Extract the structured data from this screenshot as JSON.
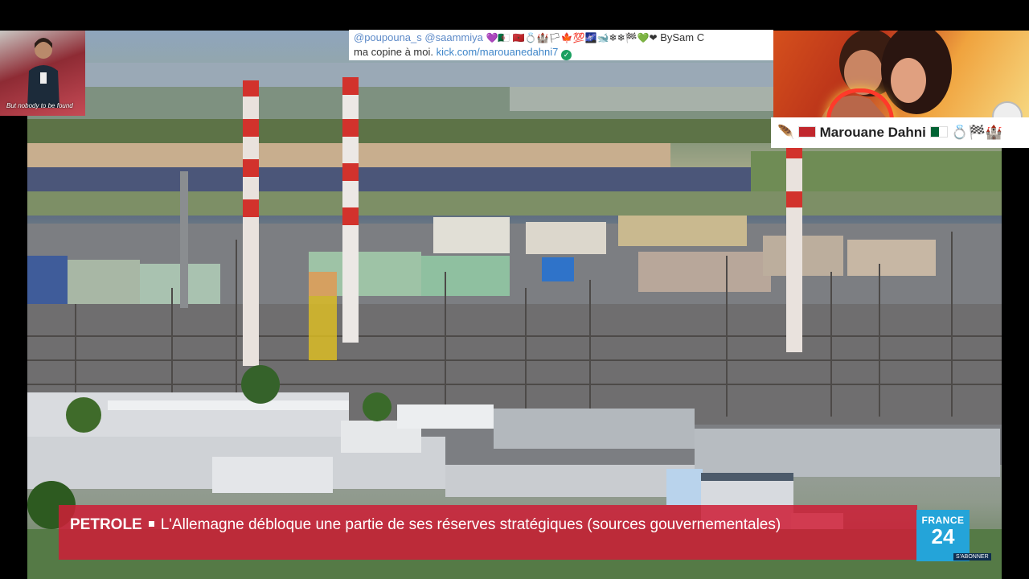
{
  "webcam": {
    "caption": "But nobody to be found"
  },
  "chat": {
    "user1": "@poupouna_s",
    "user2": "@saammiya",
    "emojis": "💜🇩🇿 🇲🇦💍🏰🏳🍁💯🌌🐋❄❄🏁💚❤",
    "signature": "BySam C",
    "line2_text": "ma copine à moi.",
    "link": "kick.com/marouanedahni7",
    "verified_icon": "check-circle-icon"
  },
  "namebar": {
    "prefix_emoji": "🪶",
    "name": "Marouane Dahni",
    "suffix_emojis": "💍🏁🏰"
  },
  "banner": {
    "keyword": "PETROLE",
    "headline": "L'Allemagne débloque une partie de ses réserves stratégiques (sources gouvernementales)"
  },
  "logo": {
    "line1": "FRANCE",
    "line2": "24",
    "subscribe": "S'ABONNER"
  },
  "colors": {
    "banner": "#cd1e37",
    "logo": "#24a4d9",
    "chat_user": "#5d8ac8",
    "link": "#3f86c9"
  }
}
